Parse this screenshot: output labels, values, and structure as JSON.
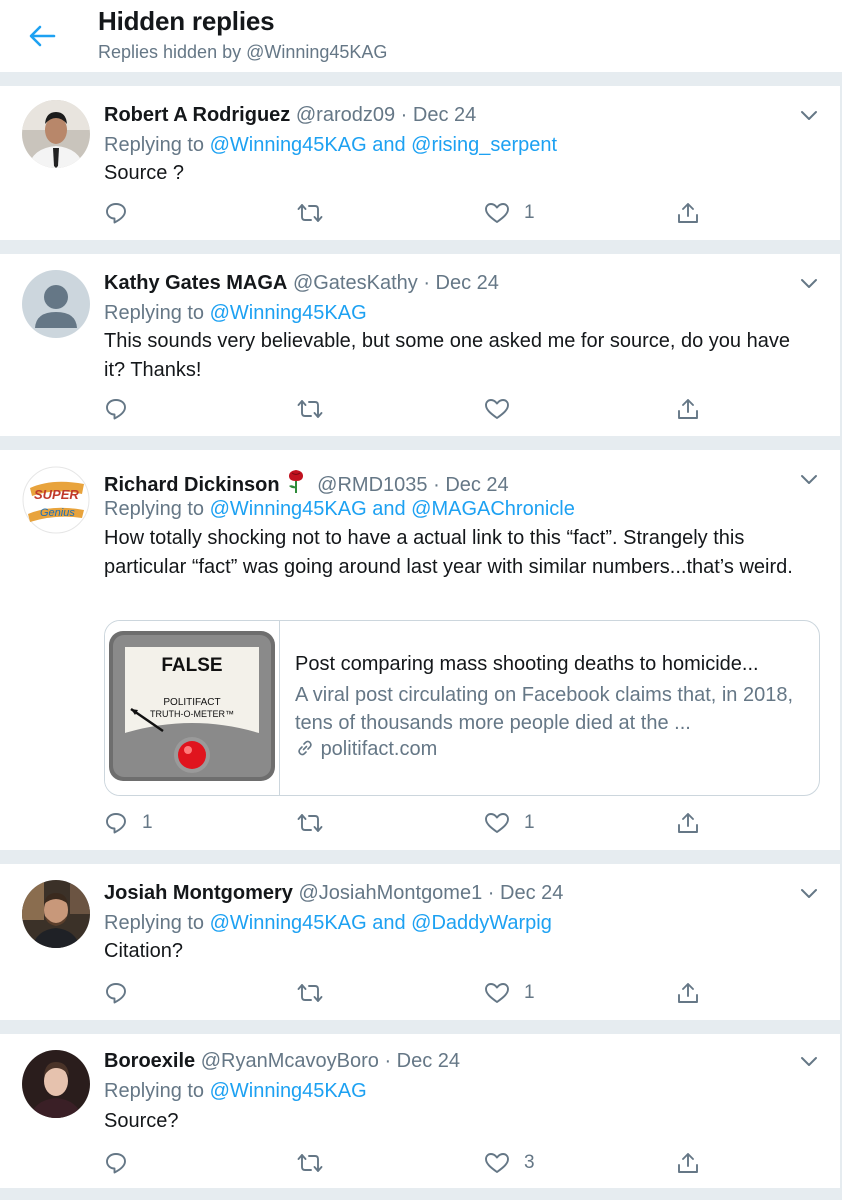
{
  "header": {
    "title": "Hidden replies",
    "subtitle": "Replies hidden by @Winning45KAG"
  },
  "replies": [
    {
      "name": "Robert A Rodriguez",
      "handle": "@rarodz09",
      "date": "Dec 24",
      "replying_prefix": "Replying to ",
      "replying_to": "@Winning45KAG and @rising_serpent",
      "text": "Source ?",
      "reply_count": "",
      "like_count": "1"
    },
    {
      "name": "Kathy Gates MAGA",
      "handle": "@GatesKathy",
      "date": "Dec 24",
      "replying_prefix": "Replying to ",
      "replying_to": "@Winning45KAG",
      "text": "This sounds very believable, but some one asked me for source, do you have it? Thanks!",
      "reply_count": "",
      "like_count": ""
    },
    {
      "name": "Richard Dickinson",
      "handle": "@RMD1035",
      "date": "Dec 24",
      "replying_prefix": "Replying to ",
      "replying_to": "@Winning45KAG and @MAGAChronicle",
      "text": "How totally shocking not to have a actual link to this “fact”. Strangely this particular “fact” was going around last year with similar numbers...that’s weird.",
      "reply_count": "1",
      "like_count": "1",
      "avatar_text": [
        "SUPER",
        "Genius"
      ],
      "card": {
        "image_text": [
          "FALSE",
          "POLITIFACT",
          "TRUTH-O-METER™"
        ],
        "title": "Post comparing mass shooting deaths to homicide...",
        "description": "A viral post circulating on Facebook claims that, in 2018, tens of thousands more people died at the ...",
        "domain": "politifact.com"
      }
    },
    {
      "name": "Josiah Montgomery",
      "handle": "@JosiahMontgome1",
      "date": "Dec 24",
      "replying_prefix": "Replying to ",
      "replying_to": "@Winning45KAG and @DaddyWarpig",
      "text": "Citation?",
      "reply_count": "",
      "like_count": "1"
    },
    {
      "name": "Boroexile",
      "handle": "@RyanMcavoyBoro",
      "date": "Dec 24",
      "replying_prefix": "Replying to ",
      "replying_to": "@Winning45KAG",
      "text": "Source?",
      "reply_count": "",
      "like_count": "3"
    }
  ],
  "separator": "·",
  "icons": [
    "back-arrow-icon",
    "chevron-down-icon",
    "reply-icon",
    "retweet-icon",
    "like-icon",
    "share-icon",
    "link-icon",
    "rose-icon"
  ],
  "colors": {
    "accent": "#1da1f2",
    "secondary_text": "#657786",
    "separator": "#e6ecf0"
  }
}
